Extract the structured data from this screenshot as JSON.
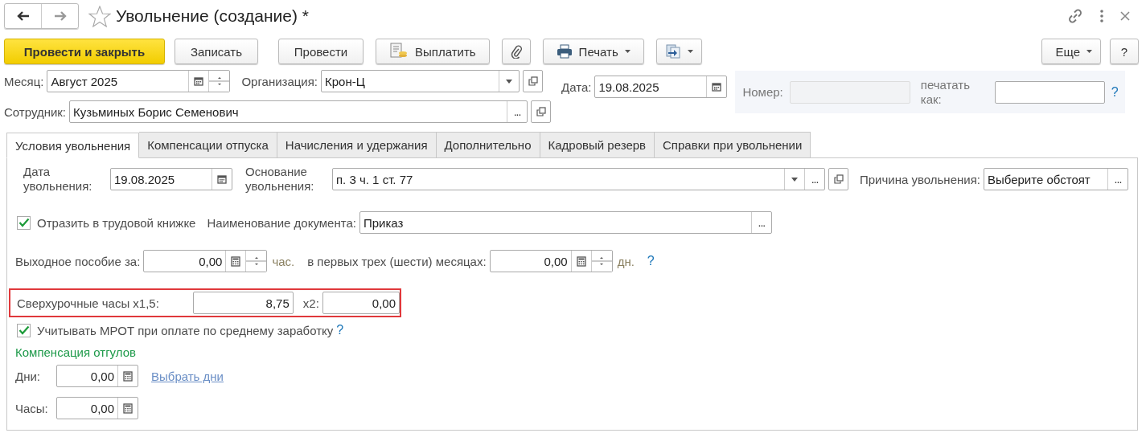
{
  "window": {
    "title": "Увольнение (создание) *",
    "favorite": false
  },
  "toolbar": {
    "primary": "Провести и закрыть",
    "save": "Записать",
    "post": "Провести",
    "pay": "Выплатить",
    "print": "Печать",
    "more": "Еще",
    "help": "?"
  },
  "header": {
    "month": {
      "label": "Месяц:",
      "value": "Август 2025"
    },
    "organization": {
      "label": "Организация:",
      "value": "Крон-Ц"
    },
    "date": {
      "label": "Дата:",
      "value": "19.08.2025"
    },
    "number": {
      "label": "Номер:",
      "disabled": true
    },
    "print_as": {
      "label": "печатать как:",
      "help": "?"
    },
    "employee": {
      "label": "Сотрудник:",
      "value": "Кузьминых Борис Семенович",
      "select_button": "..."
    }
  },
  "tabs": [
    {
      "label": "Условия увольнения",
      "selected": true
    },
    {
      "label": "Компенсации отпуска",
      "selected": false
    },
    {
      "label": "Начисления и удержания",
      "selected": false
    },
    {
      "label": "Дополнительно",
      "selected": false
    },
    {
      "label": "Кадровый резерв",
      "selected": false
    },
    {
      "label": "Справки при увольнении",
      "selected": false
    }
  ],
  "conditions": {
    "dismissal_date": {
      "label": "Дата увольнения:",
      "value": "19.08.2025"
    },
    "basis": {
      "label": "Основание увольнения:",
      "value": "п. 3 ч. 1 ст. 77",
      "select_button": "..."
    },
    "reason": {
      "label": "Причина увольнения:",
      "value": "Выберите обстоят",
      "select_button": "..."
    },
    "work_book": {
      "label": "Отразить в трудовой книжке",
      "checked": true
    },
    "document_name": {
      "label": "Наименование документа:",
      "value": "Приказ",
      "select_button": "..."
    },
    "severance": {
      "label": "Выходное пособие за:",
      "value": "0,00",
      "unit": "час."
    },
    "first_months": {
      "label": "в первых трех (шести) месяцах:",
      "value": "0,00",
      "unit": "дн.",
      "help": "?"
    },
    "overtime": {
      "label": "Сверхурочные часы x1,5:",
      "value": "8,75",
      "x2_label": "x2:",
      "x2_value": "0,00",
      "highlighted": true
    },
    "mrot": {
      "label": "Учитывать МРОТ при оплате по среднему заработку",
      "checked": true,
      "help": "?"
    },
    "comp_title": "Компенсация отгулов",
    "days": {
      "label": "Дни:",
      "value": "0,00",
      "link": "Выбрать дни"
    },
    "hours": {
      "label": "Часы:",
      "value": "0,00"
    }
  }
}
